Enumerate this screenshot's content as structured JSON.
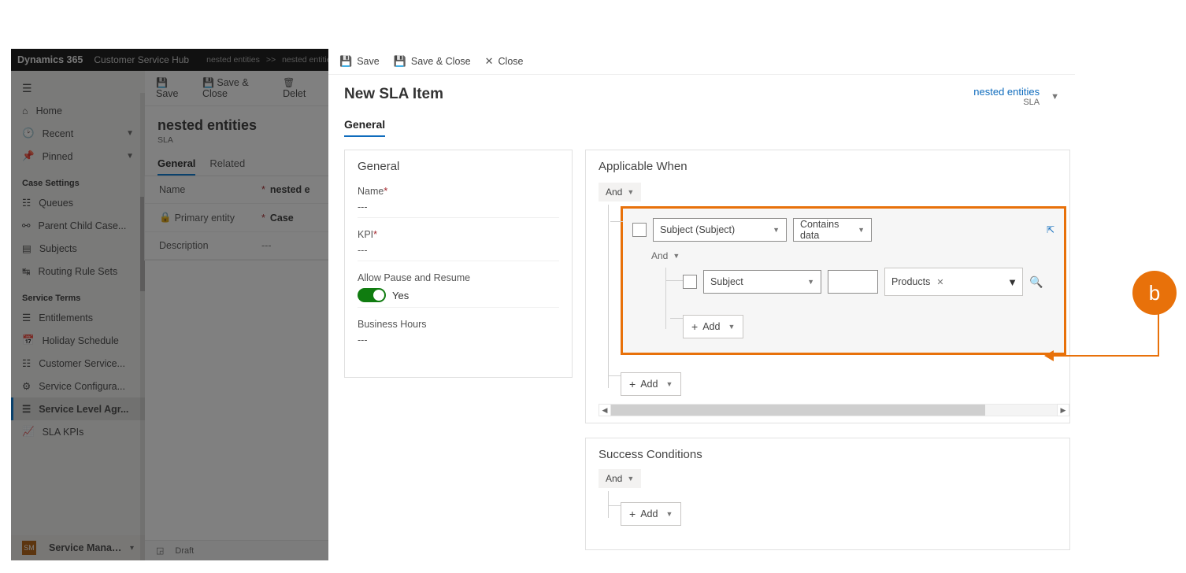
{
  "colors": {
    "accent": "#0f6cbd",
    "highlight": "#e8710a",
    "toggle_on": "#107c10",
    "required": "#a4262c"
  },
  "background": {
    "topbar": {
      "brand": "Dynamics 365",
      "app": "Customer Service Hub",
      "breadcrumbs": [
        "nested entities",
        "nested entitie"
      ]
    },
    "nav": {
      "top": [
        {
          "icon": "home-icon",
          "label": "Home"
        },
        {
          "icon": "clock-icon",
          "label": "Recent",
          "expandable": true
        },
        {
          "icon": "pin-icon",
          "label": "Pinned",
          "expandable": true
        }
      ],
      "section_case_label": "Case Settings",
      "case_items": [
        {
          "icon": "queue-icon",
          "label": "Queues"
        },
        {
          "icon": "parent-child-icon",
          "label": "Parent Child Case..."
        },
        {
          "icon": "subjects-icon",
          "label": "Subjects"
        },
        {
          "icon": "routing-icon",
          "label": "Routing Rule Sets"
        }
      ],
      "section_service_label": "Service Terms",
      "service_items": [
        {
          "icon": "entitlements-icon",
          "label": "Entitlements"
        },
        {
          "icon": "schedule-icon",
          "label": "Holiday Schedule"
        },
        {
          "icon": "customer-service-icon",
          "label": "Customer Service..."
        },
        {
          "icon": "config-icon",
          "label": "Service Configura..."
        },
        {
          "icon": "sla-icon",
          "label": "Service Level Agr...",
          "active": true
        },
        {
          "icon": "kpi-icon",
          "label": "SLA KPIs"
        }
      ],
      "area_switch": {
        "avatar": "SM",
        "label": "Service Managem..."
      }
    },
    "commands": {
      "save": "Save",
      "save_close": "Save & Close",
      "delete": "Delet"
    },
    "record": {
      "title": "nested entities",
      "subtitle": "SLA",
      "tabs": [
        "General",
        "Related"
      ],
      "active_tab": "General",
      "fields": [
        {
          "label": "Name",
          "required": true,
          "value": "nested e"
        },
        {
          "label": "Primary entity",
          "required": true,
          "icon": "lock-icon",
          "value": "Case"
        },
        {
          "label": "Description",
          "required": false,
          "value": "---"
        }
      ],
      "footer_status": "Draft"
    }
  },
  "foreground": {
    "commands": {
      "save": "Save",
      "save_close": "Save & Close",
      "close": "Close"
    },
    "title": "New SLA Item",
    "header_ref": {
      "name": "nested entities",
      "type": "SLA"
    },
    "tabs": [
      "General"
    ],
    "active_tab": "General",
    "general_card": {
      "title": "General",
      "fields": {
        "name_label": "Name",
        "name_value": "---",
        "kpi_label": "KPI",
        "kpi_value": "---",
        "pause_label": "Allow Pause and Resume",
        "pause_value_text": "Yes",
        "biz_label": "Business Hours",
        "biz_value": "---"
      }
    },
    "applicable_card": {
      "title": "Applicable When",
      "root_operator": "And",
      "condition1": {
        "field": "Subject (Subject)",
        "operator": "Contains data"
      },
      "nested_operator": "And",
      "condition2": {
        "field": "Subject",
        "tag_value": "Products"
      },
      "add_label": "Add"
    },
    "success_card": {
      "title": "Success Conditions",
      "root_operator": "And",
      "add_label": "Add"
    }
  },
  "annotation": {
    "label": "b"
  }
}
